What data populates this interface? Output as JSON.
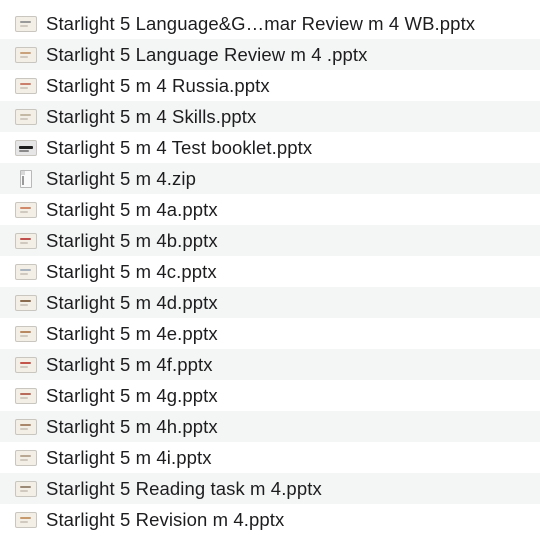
{
  "files": [
    {
      "name": "Starlight 5  Language&G…mar Review m 4 WB.pptx",
      "icon": "pptx-thumbnail-icon",
      "accent": "#9a9a9a",
      "style": "plain"
    },
    {
      "name": "Starlight 5 Language Review m 4 .pptx",
      "icon": "pptx-thumbnail-icon",
      "accent": "#c9a27c",
      "style": "plain"
    },
    {
      "name": "Starlight 5 m 4 Russia.pptx",
      "icon": "pptx-thumbnail-icon",
      "accent": "#c97f6b",
      "style": "plain"
    },
    {
      "name": "Starlight 5 m 4 Skills.pptx",
      "icon": "pptx-thumbnail-icon",
      "accent": "#c4b9a4",
      "style": "plain"
    },
    {
      "name": "Starlight 5 m 4 Test booklet.pptx",
      "icon": "pptx-thumbnail-icon",
      "accent": "#1e1e1e",
      "style": "dark"
    },
    {
      "name": "Starlight 5 m 4.zip",
      "icon": "zip-file-icon",
      "accent": "#9a9a9a",
      "style": "zip"
    },
    {
      "name": "Starlight 5 m 4a.pptx",
      "icon": "pptx-thumbnail-icon",
      "accent": "#d08a6a",
      "style": "plain"
    },
    {
      "name": "Starlight 5 m 4b.pptx",
      "icon": "pptx-thumbnail-icon",
      "accent": "#c0504d",
      "style": "plain"
    },
    {
      "name": "Starlight 5 m 4c.pptx",
      "icon": "pptx-thumbnail-icon",
      "accent": "#a9b4bf",
      "style": "plain"
    },
    {
      "name": "Starlight 5 m 4d.pptx",
      "icon": "pptx-thumbnail-icon",
      "accent": "#8a6b4e",
      "style": "plain"
    },
    {
      "name": "Starlight 5 m 4e.pptx",
      "icon": "pptx-thumbnail-icon",
      "accent": "#b98a62",
      "style": "plain"
    },
    {
      "name": "Starlight 5 m 4f.pptx",
      "icon": "pptx-thumbnail-icon",
      "accent": "#c4534a",
      "style": "plain"
    },
    {
      "name": "Starlight 5 m 4g.pptx",
      "icon": "pptx-thumbnail-icon",
      "accent": "#b86b5a",
      "style": "plain"
    },
    {
      "name": "Starlight 5 m 4h.pptx",
      "icon": "pptx-thumbnail-icon",
      "accent": "#a8876a",
      "style": "plain"
    },
    {
      "name": "Starlight 5 m 4i.pptx",
      "icon": "pptx-thumbnail-icon",
      "accent": "#b9a994",
      "style": "plain"
    },
    {
      "name": "Starlight 5 Reading task m 4.pptx",
      "icon": "pptx-thumbnail-icon",
      "accent": "#9c8a76",
      "style": "plain"
    },
    {
      "name": "Starlight 5 Revision m 4.pptx",
      "icon": "pptx-thumbnail-icon",
      "accent": "#c79a6e",
      "style": "plain"
    }
  ]
}
